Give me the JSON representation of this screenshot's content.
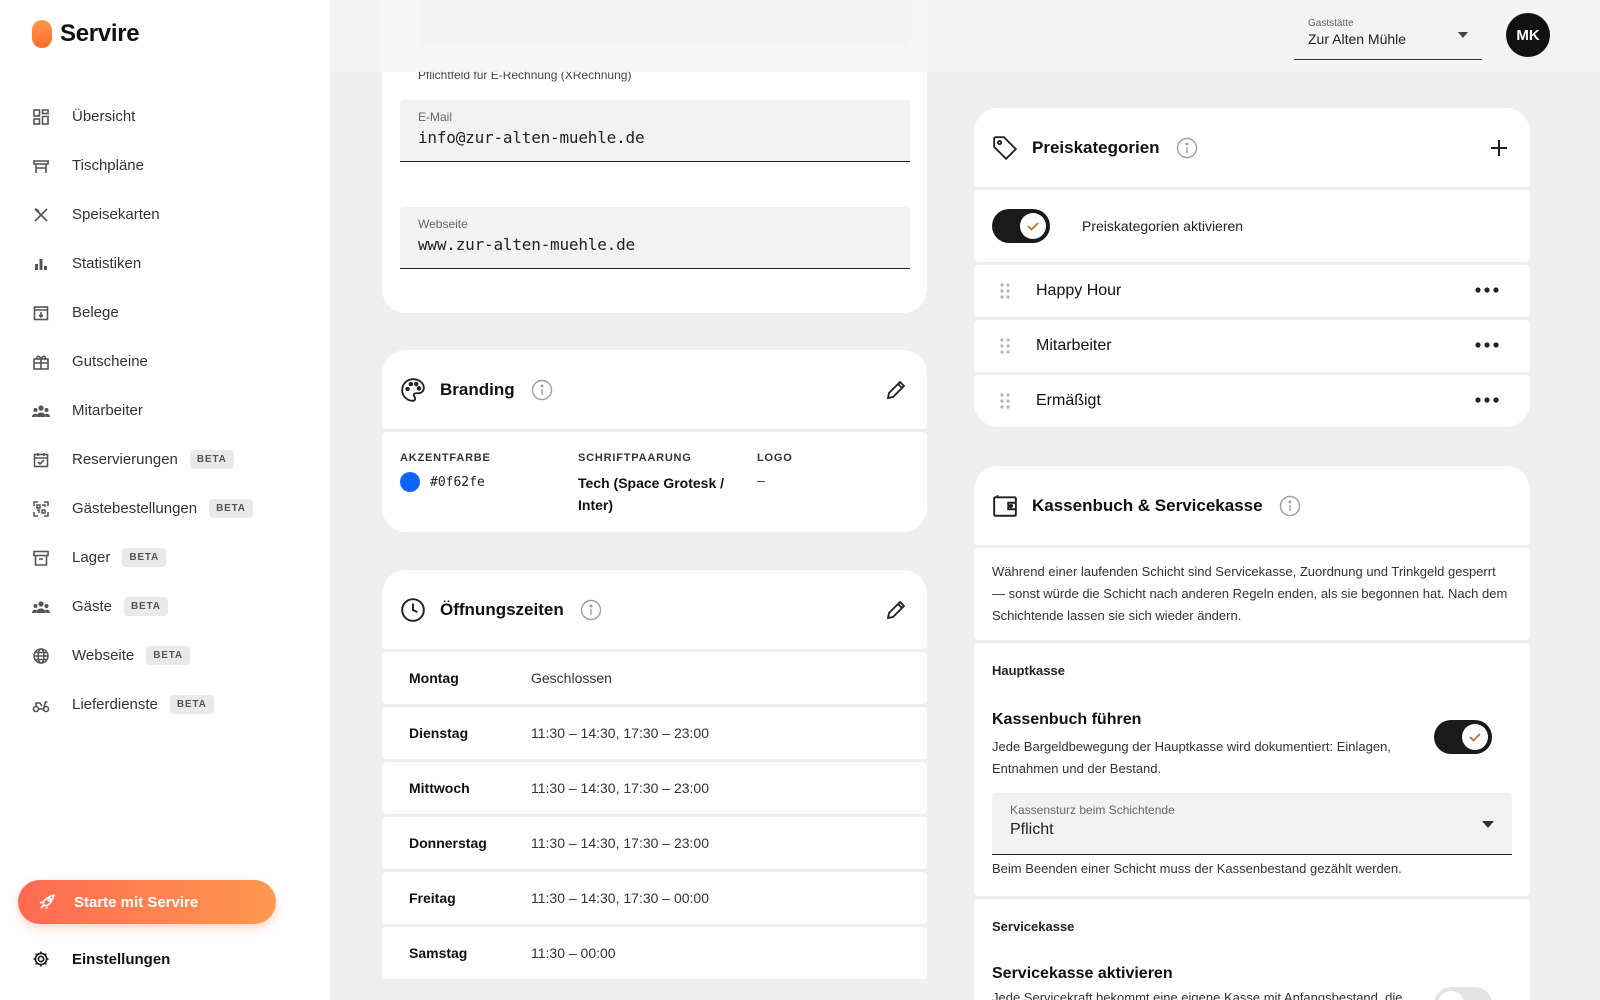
{
  "brand": {
    "name": "Servire"
  },
  "sidebar": {
    "items": [
      {
        "label": "Übersicht",
        "icon": "dashboard-icon",
        "beta": ""
      },
      {
        "label": "Tischpläne",
        "icon": "table-icon",
        "beta": ""
      },
      {
        "label": "Speisekarten",
        "icon": "cutlery-icon",
        "beta": ""
      },
      {
        "label": "Statistiken",
        "icon": "bar-chart-icon",
        "beta": ""
      },
      {
        "label": "Belege",
        "icon": "receipt-icon",
        "beta": ""
      },
      {
        "label": "Gutscheine",
        "icon": "gift-icon",
        "beta": ""
      },
      {
        "label": "Mitarbeiter",
        "icon": "team-icon",
        "beta": ""
      },
      {
        "label": "Reservierungen",
        "icon": "calendar-icon",
        "beta": "BETA"
      },
      {
        "label": "Gästebestellungen",
        "icon": "qr-icon",
        "beta": "BETA"
      },
      {
        "label": "Lager",
        "icon": "archive-icon",
        "beta": "BETA"
      },
      {
        "label": "Gäste",
        "icon": "guests-icon",
        "beta": "BETA"
      },
      {
        "label": "Webseite",
        "icon": "globe-icon",
        "beta": "BETA"
      },
      {
        "label": "Lieferdienste",
        "icon": "scooter-icon",
        "beta": "BETA"
      }
    ],
    "cta_label": "Starte mit Servire",
    "settings_label": "Einstellungen"
  },
  "topbar": {
    "venue_label": "Gaststätte",
    "venue_value": "Zur Alten Mühle",
    "avatar_initials": "MK"
  },
  "contact": {
    "hint": "Pflichtfeld für E-Rechnung (XRechnung)",
    "email_label": "E-Mail",
    "email_value": "info@zur-alten-muehle.de",
    "website_label": "Webseite",
    "website_value": "www.zur-alten-muehle.de"
  },
  "branding": {
    "title": "Branding",
    "accent_label": "AKZENTFARBE",
    "accent_value": "#0f62fe",
    "accent_color": "#0f62fe",
    "font_label": "SCHRIFTPAARUNG",
    "font_value": "Tech (Space Grotesk / Inter)",
    "logo_label": "LOGO",
    "logo_value": "–"
  },
  "hours": {
    "title": "Öffnungszeiten",
    "rows": [
      {
        "day": "Montag",
        "time": "Geschlossen"
      },
      {
        "day": "Dienstag",
        "time": "11:30 – 14:30, 17:30 – 23:00"
      },
      {
        "day": "Mittwoch",
        "time": "11:30 – 14:30, 17:30 – 23:00"
      },
      {
        "day": "Donnerstag",
        "time": "11:30 – 14:30, 17:30 – 23:00"
      },
      {
        "day": "Freitag",
        "time": "11:30 – 14:30, 17:30 – 00:00"
      },
      {
        "day": "Samstag",
        "time": "11:30 – 00:00"
      }
    ]
  },
  "prices": {
    "title": "Preiskategorien",
    "toggle_label": "Preiskategorien aktivieren",
    "toggle_on": true,
    "items": [
      "Happy Hour",
      "Mitarbeiter",
      "Ermäßigt"
    ]
  },
  "cashbook": {
    "title": "Kassenbuch & Servicekasse",
    "notice": "Während einer laufenden Schicht sind Servicekasse, Zuordnung und Trinkgeld gesperrt — sonst würde die Schicht nach anderen Regeln enden, als sie begonnen hat. Nach dem Schichtende lassen sie sich wieder ändern.",
    "main_section": "Hauptkasse",
    "keep_title": "Kassenbuch führen",
    "keep_desc": "Jede Bargeldbewegung der Hauptkasse wird dokumentiert: Einlagen, Entnahmen und der Bestand.",
    "keep_on": true,
    "count_label": "Kassensturz beim Schichtende",
    "count_value": "Pflicht",
    "count_hint": "Beim Beenden einer Schicht muss der Kassenbestand gezählt werden.",
    "service_section": "Servicekasse",
    "service_title": "Servicekasse aktivieren",
    "service_desc": "Jede Servicekraft bekommt eine eigene Kasse mit Anfangsbestand, die",
    "service_on": false
  }
}
